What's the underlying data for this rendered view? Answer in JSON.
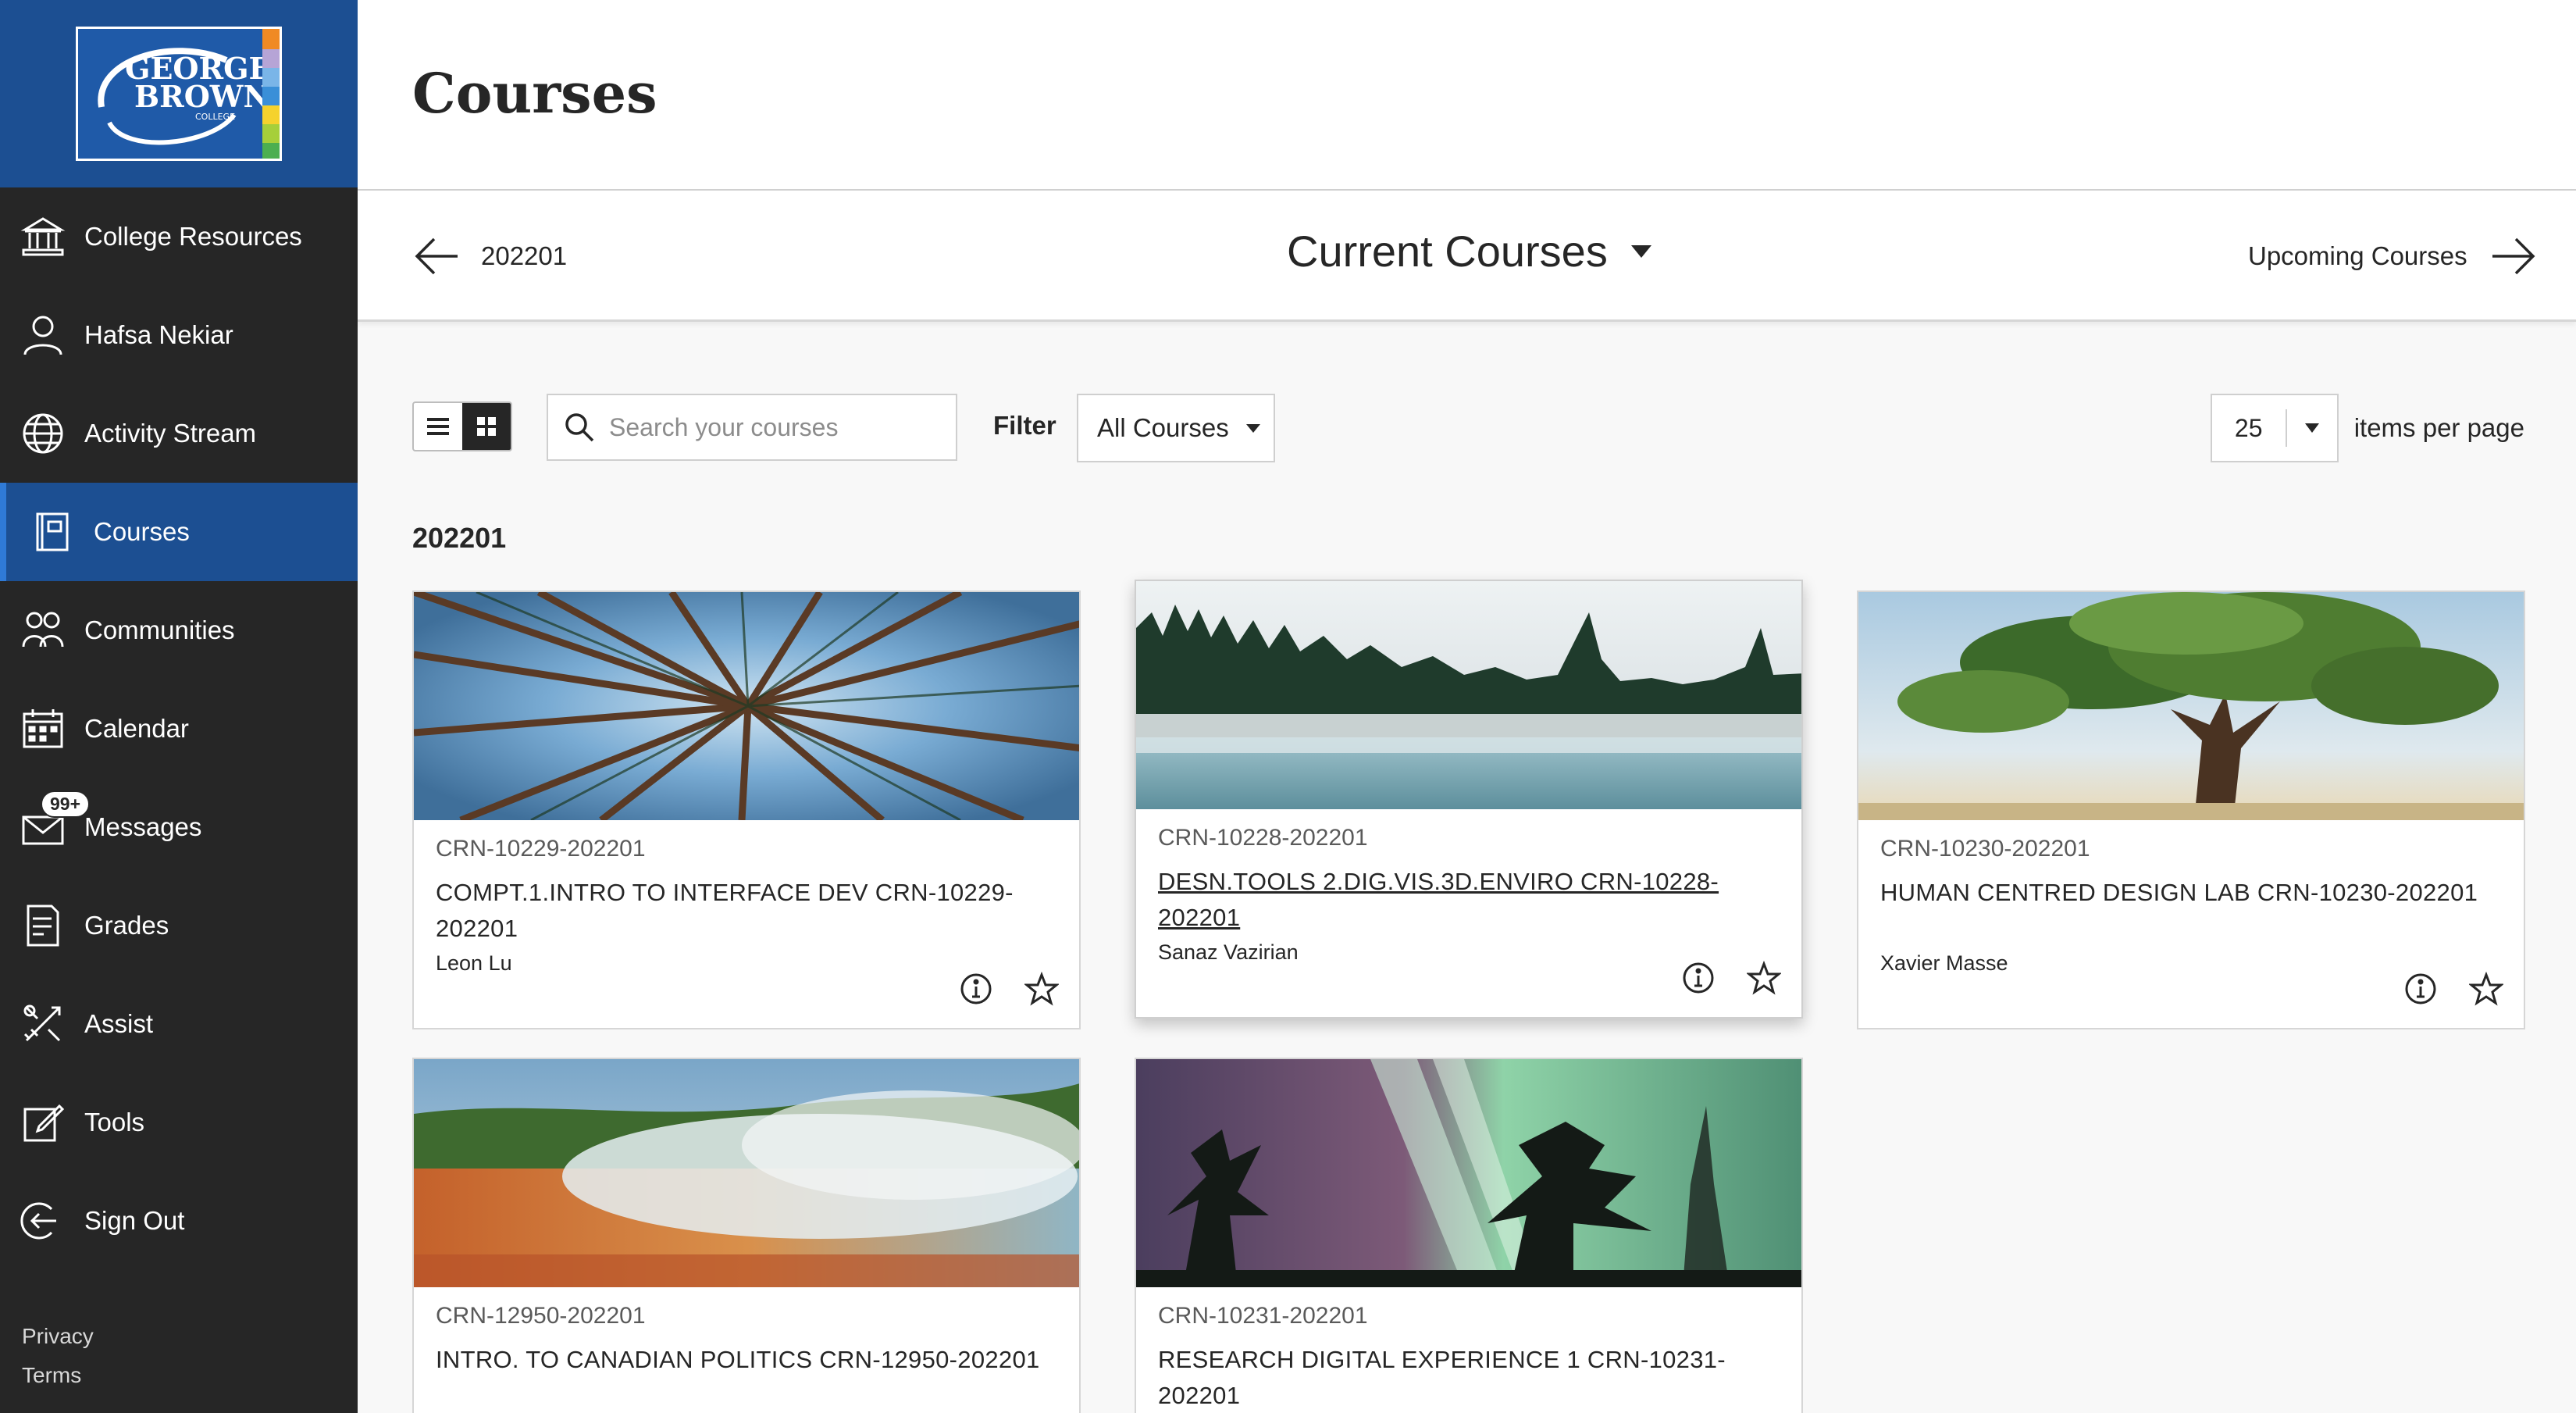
{
  "logo": {
    "text_line1": "GEORGE",
    "text_line2": "BROWN",
    "text_line3": "COLLEGE"
  },
  "sidebar": {
    "items": [
      {
        "label": "College Resources",
        "icon": "institution-icon"
      },
      {
        "label": "Hafsa Nekiar",
        "icon": "user-icon"
      },
      {
        "label": "Activity Stream",
        "icon": "globe-icon"
      },
      {
        "label": "Courses",
        "icon": "book-icon",
        "active": true
      },
      {
        "label": "Communities",
        "icon": "group-icon"
      },
      {
        "label": "Calendar",
        "icon": "calendar-icon"
      },
      {
        "label": "Messages",
        "icon": "envelope-icon",
        "badge": "99+"
      },
      {
        "label": "Grades",
        "icon": "grades-icon"
      },
      {
        "label": "Assist",
        "icon": "tools-cross-icon"
      },
      {
        "label": "Tools",
        "icon": "edit-icon"
      },
      {
        "label": "Sign Out",
        "icon": "signout-icon"
      }
    ],
    "footer": {
      "privacy": "Privacy",
      "terms": "Terms"
    }
  },
  "header": {
    "title": "Courses"
  },
  "term_nav": {
    "prev_label": "202201",
    "current_label": "Current Courses",
    "next_label": "Upcoming Courses"
  },
  "toolbar": {
    "search_placeholder": "Search your courses",
    "filter_label": "Filter",
    "filter_value": "All Courses",
    "per_page_value": "25",
    "per_page_label": "items per page"
  },
  "group_title": "202201",
  "courses": [
    {
      "crn": "CRN-10229-202201",
      "title": "COMPT.1.INTRO TO INTERFACE DEV CRN-10229-202201",
      "instructor": "Leon Lu",
      "image": "tree-canopy"
    },
    {
      "crn": "CRN-10228-202201",
      "title": "DESN.TOOLS 2.DIG.VIS.3D.ENVIRO CRN-10228-202201",
      "instructor": "Sanaz Vazirian",
      "image": "misty-lake"
    },
    {
      "crn": "CRN-10230-202201",
      "title": "HUMAN CENTRED DESIGN LAB CRN-10230-202201",
      "instructor": "Xavier Masse",
      "image": "big-tree"
    },
    {
      "crn": "CRN-12950-202201",
      "title": "INTRO. TO CANADIAN POLITICS CRN-12950-202201",
      "instructor": "",
      "image": "hot-spring"
    },
    {
      "crn": "CRN-10231-202201",
      "title": "RESEARCH DIGITAL EXPERIENCE 1 CRN-10231-202201",
      "instructor": "",
      "image": "aurora"
    }
  ],
  "colors": {
    "sidebar_bg": "#262626",
    "brand_blue": "#1c4f92",
    "active_accent": "#2f7ad6"
  }
}
